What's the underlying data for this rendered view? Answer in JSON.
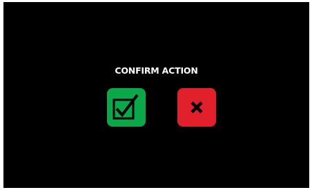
{
  "dialog": {
    "title": "CONFIRM ACTION",
    "confirm_icon": "checkbox-check-icon",
    "cancel_icon": "x-icon"
  },
  "colors": {
    "background": "#000000",
    "title_text": "#ffffff",
    "confirm_button": "#0ba84a",
    "cancel_button": "#e2202c",
    "icon_stroke": "#000000"
  }
}
